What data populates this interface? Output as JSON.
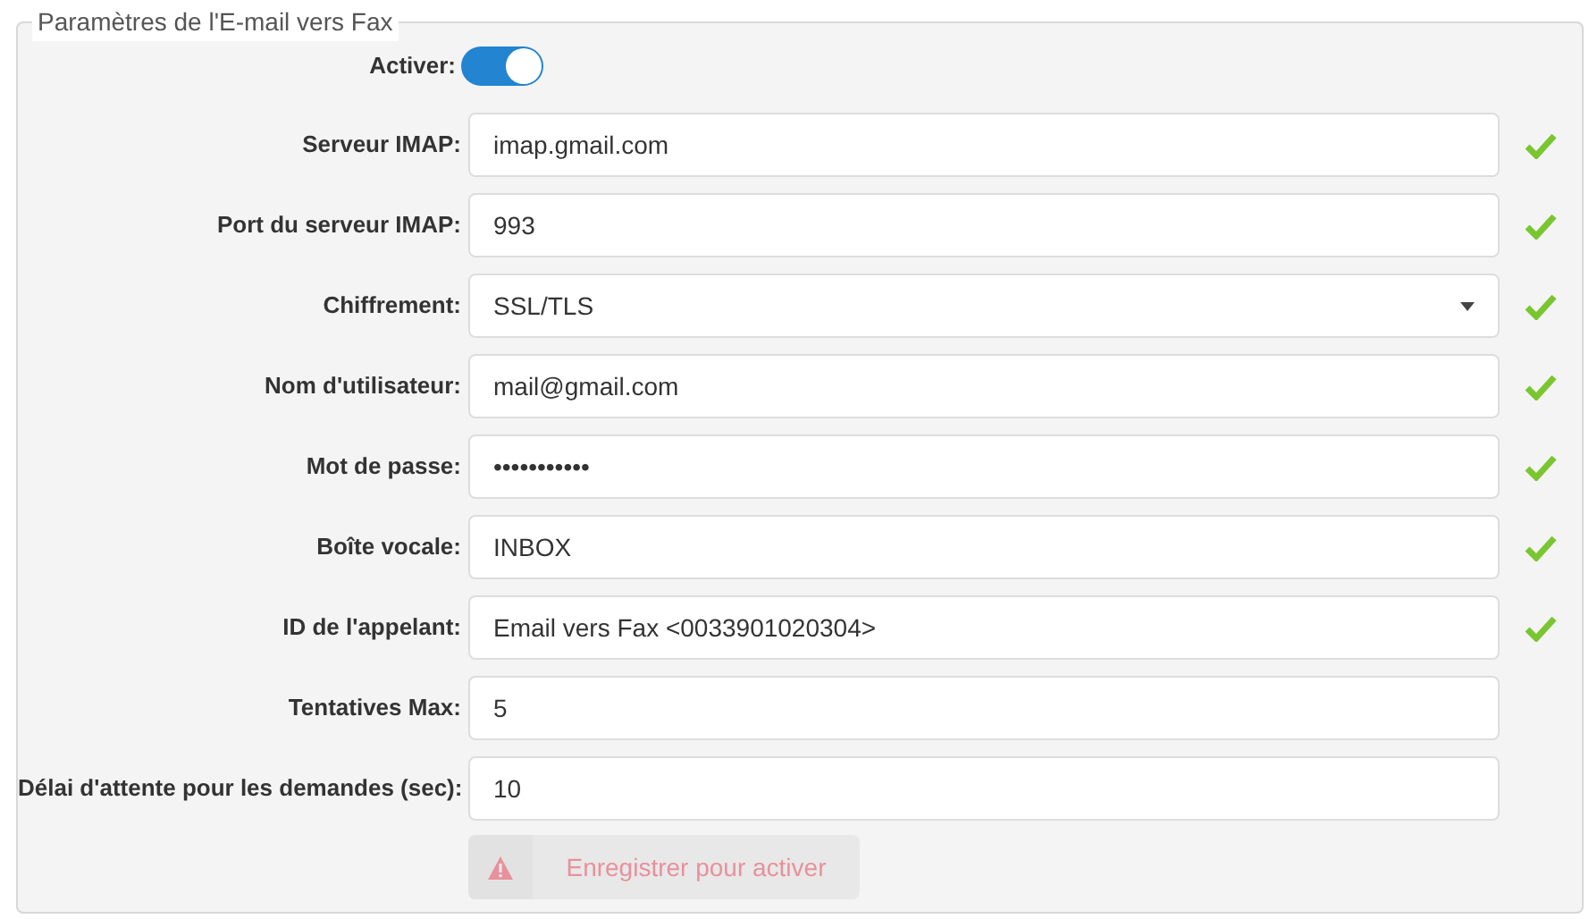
{
  "legend": "Paramètres de l'E-mail vers Fax",
  "enable": {
    "label": "Activer:",
    "on": true
  },
  "fields": [
    {
      "label": "Serveur IMAP:",
      "kind": "text",
      "value": "imap.gmail.com",
      "valid": true
    },
    {
      "label": "Port du serveur IMAP:",
      "kind": "text",
      "value": "993",
      "valid": true
    },
    {
      "label": "Chiffrement:",
      "kind": "select",
      "value": "SSL/TLS",
      "valid": true
    },
    {
      "label": "Nom d'utilisateur:",
      "kind": "text",
      "value": "mail@gmail.com",
      "valid": true
    },
    {
      "label": "Mot de passe:",
      "kind": "password",
      "value": "•••••••••••",
      "valid": true
    },
    {
      "label": "Boîte vocale:",
      "kind": "text",
      "value": "INBOX",
      "valid": true
    },
    {
      "label": "ID de l'appelant:",
      "kind": "text",
      "value": "Email vers Fax <0033901020304>",
      "valid": true
    },
    {
      "label": "Tentatives Max:",
      "kind": "text",
      "value": "5",
      "valid": false
    },
    {
      "label": "Délai d'attente pour les demandes (sec):",
      "kind": "text",
      "value": "10",
      "valid": false
    }
  ],
  "save_button": {
    "label": "Enregistrer pour activer",
    "disabled": true
  }
}
